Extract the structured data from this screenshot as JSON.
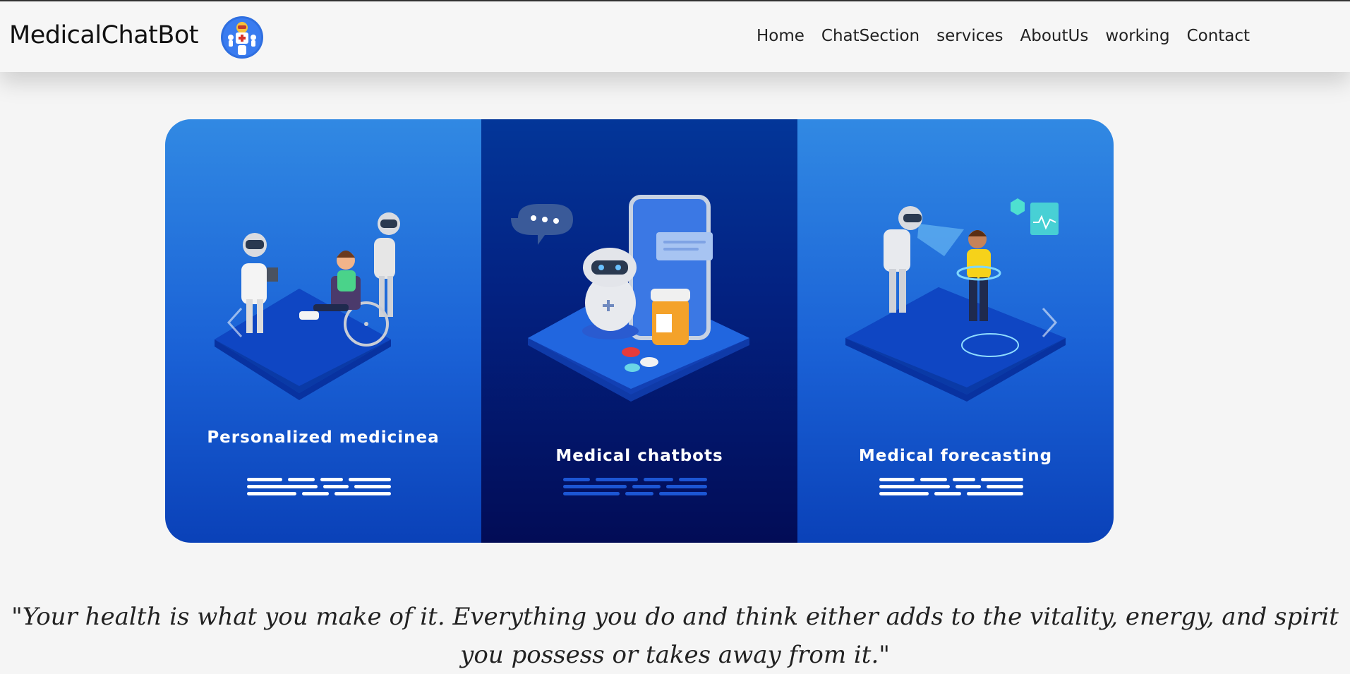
{
  "header": {
    "brand": "MedicalChatBot",
    "nav": [
      "Home",
      "ChatSection",
      "services",
      "AboutUs",
      "working",
      "Contact"
    ]
  },
  "carousel": {
    "slides": [
      {
        "title": "Personalized medicinea"
      },
      {
        "title": "Medical chatbots"
      },
      {
        "title": "Medical forecasting"
      }
    ]
  },
  "quote": "\"Your health is what you make of it. Everything you do and think either adds to the vitality, energy, and spirit you possess or takes away from it.\"",
  "colors": {
    "brand_blue": "#2f6fe0",
    "panel_light": "#2a7ce0",
    "panel_dark": "#031f7e",
    "text": "#222222"
  }
}
